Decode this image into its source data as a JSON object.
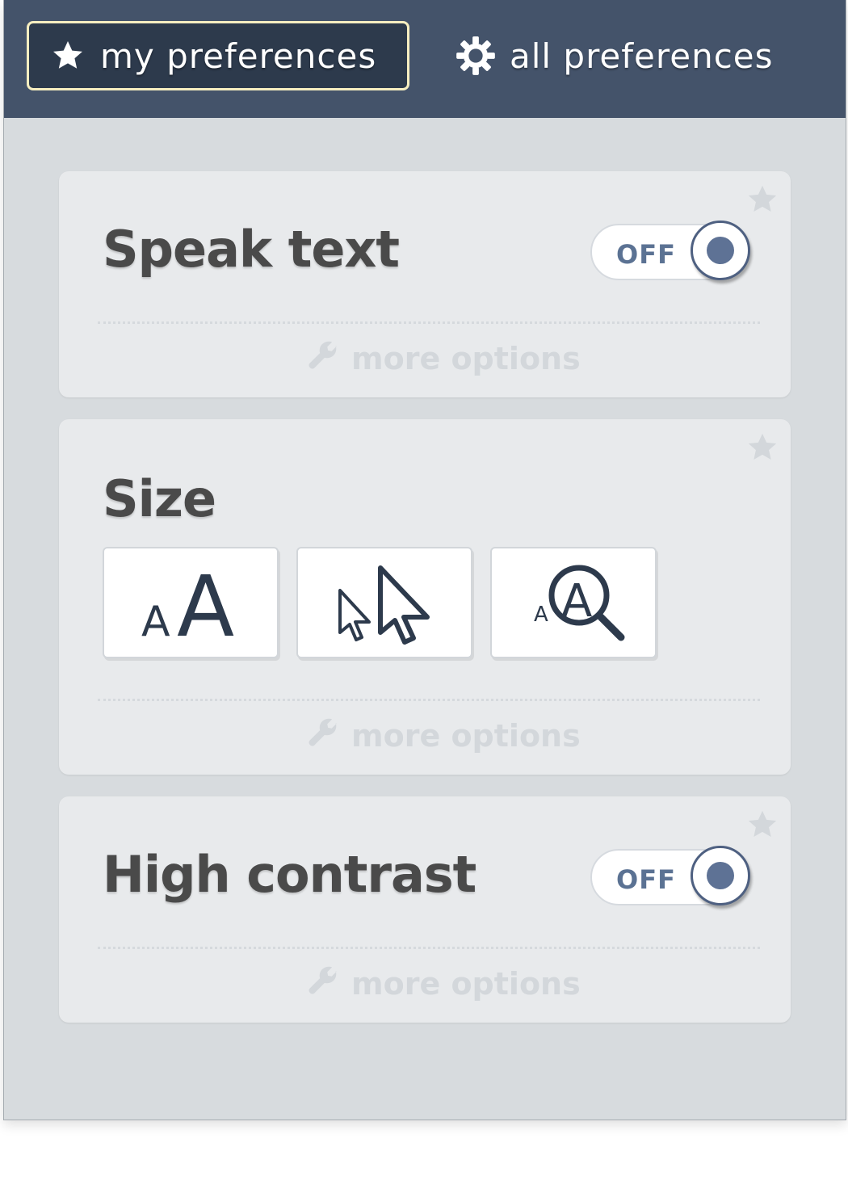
{
  "tabs": {
    "my_preferences": "my preferences",
    "all_preferences": "all preferences"
  },
  "cards": {
    "speak_text": {
      "title": "Speak text",
      "switch_label": "OFF",
      "more_options": "more options"
    },
    "size": {
      "title": "Size",
      "buttons": [
        "text-size-icon",
        "pointer-size-icon",
        "magnifier-icon"
      ],
      "more_options": "more options"
    },
    "high_contrast": {
      "title": "High contrast",
      "switch_label": "OFF",
      "more_options": "more options"
    }
  },
  "colors": {
    "tab_bar": "#44536a",
    "active_tab_border": "#f6eec0",
    "panel_bg": "#d7dbde",
    "card_bg": "#e8eaec",
    "switch_text": "#5b7293",
    "title_text": "#4a4a4a",
    "muted_text": "#d3d7db"
  }
}
